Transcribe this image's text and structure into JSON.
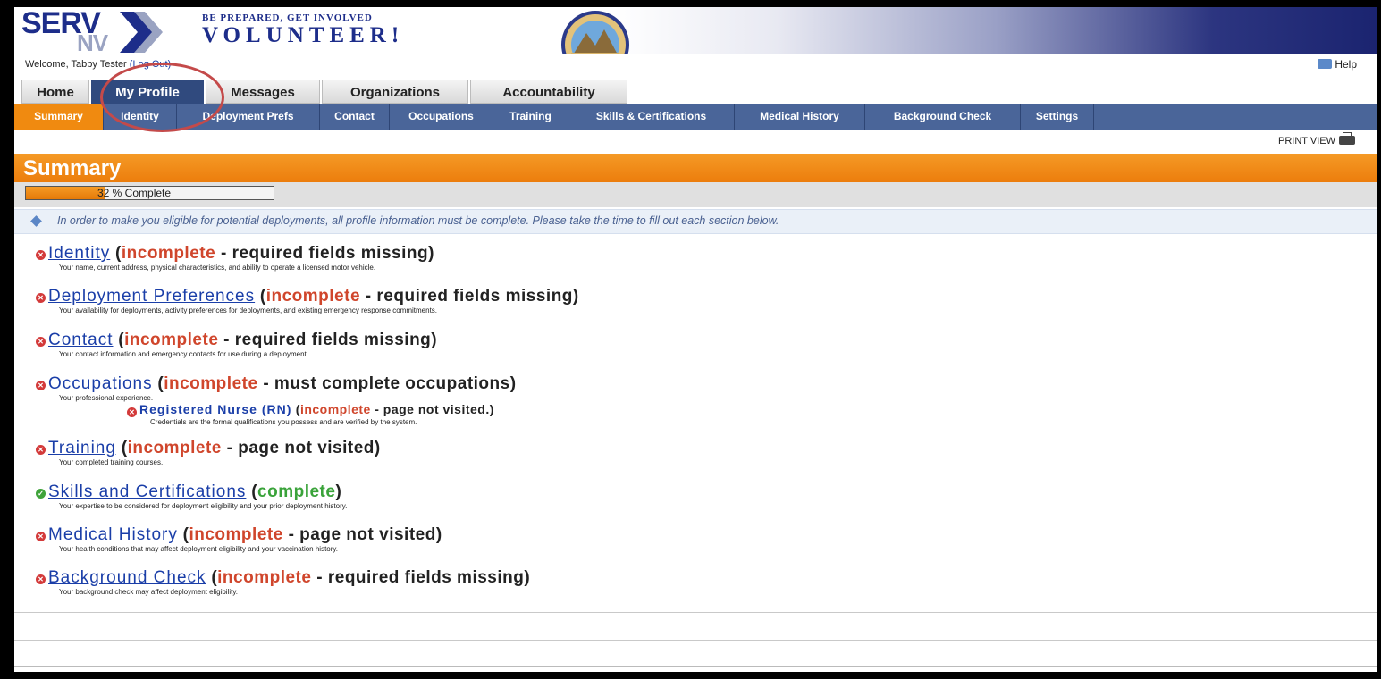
{
  "header": {
    "logo_text": "SERV",
    "logo_sub": "NV",
    "tagline_small": "BE PREPARED, GET INVOLVED",
    "tagline_big": "VOLUNTEER!"
  },
  "user_bar": {
    "welcome_text": "Welcome, Tabby Tester",
    "logout_label": "(Log Out)",
    "help_label": "Help"
  },
  "main_tabs": [
    {
      "label": "Home",
      "active": false
    },
    {
      "label": "My Profile",
      "active": true
    },
    {
      "label": "Messages",
      "active": false
    },
    {
      "label": "Organizations",
      "active": false
    },
    {
      "label": "Accountability",
      "active": false
    }
  ],
  "sub_tabs": [
    {
      "label": "Summary",
      "active": true
    },
    {
      "label": "Identity",
      "active": false
    },
    {
      "label": "Deployment Prefs",
      "active": false
    },
    {
      "label": "Contact",
      "active": false
    },
    {
      "label": "Occupations",
      "active": false
    },
    {
      "label": "Training",
      "active": false
    },
    {
      "label": "Skills & Certifications",
      "active": false
    },
    {
      "label": "Medical History",
      "active": false
    },
    {
      "label": "Background Check",
      "active": false
    },
    {
      "label": "Settings",
      "active": false
    }
  ],
  "print_view_label": "PRINT VIEW",
  "summary": {
    "title": "Summary",
    "progress_text": "32 % Complete",
    "progress_fraction": 0.32,
    "info_message": "In order to make you eligible for potential deployments, all profile information must be complete. Please take the time to fill out each section below."
  },
  "sections": [
    {
      "name": "Identity",
      "status": "incomplete",
      "reason": " - required fields missing)",
      "desc": "Your name, current address, physical characteristics, and ability to operate a licensed motor vehicle."
    },
    {
      "name": "Deployment Preferences",
      "status": "incomplete",
      "reason": " - required fields missing)",
      "desc": "Your availability for deployments, activity preferences for deployments, and existing emergency response commitments."
    },
    {
      "name": "Contact",
      "status": "incomplete",
      "reason": " - required fields missing)",
      "desc": "Your contact information and emergency contacts for use during a deployment."
    },
    {
      "name": "Occupations",
      "status": "incomplete",
      "reason": " - must complete occupations)",
      "desc": "Your professional experience."
    },
    {
      "name": "Training",
      "status": "incomplete",
      "reason": " - page not visited)",
      "desc": "Your completed training courses."
    },
    {
      "name": "Skills and Certifications",
      "status": "complete",
      "reason": ")",
      "desc": "Your expertise to be considered for deployment eligibility and your prior deployment history."
    },
    {
      "name": "Medical History",
      "status": "incomplete",
      "reason": " - page not visited)",
      "desc": "Your health conditions that may affect deployment eligibility and your vaccination history."
    },
    {
      "name": "Background Check",
      "status": "incomplete",
      "reason": " - required fields missing)",
      "desc": "Your background check may affect deployment eligibility."
    }
  ],
  "occupation_sub": {
    "name": "Registered Nurse (RN)",
    "status": "incomplete",
    "reason": " - page not visited.)",
    "desc": "Credentials are the formal qualifications you possess and are verified by the system."
  },
  "colors": {
    "nav_blue": "#304a7e",
    "subnav_blue": "#4a6599",
    "orange": "#f08a10",
    "incomplete_red": "#d0462c",
    "complete_green": "#3aa33a",
    "link_blue": "#1a3ea8"
  }
}
